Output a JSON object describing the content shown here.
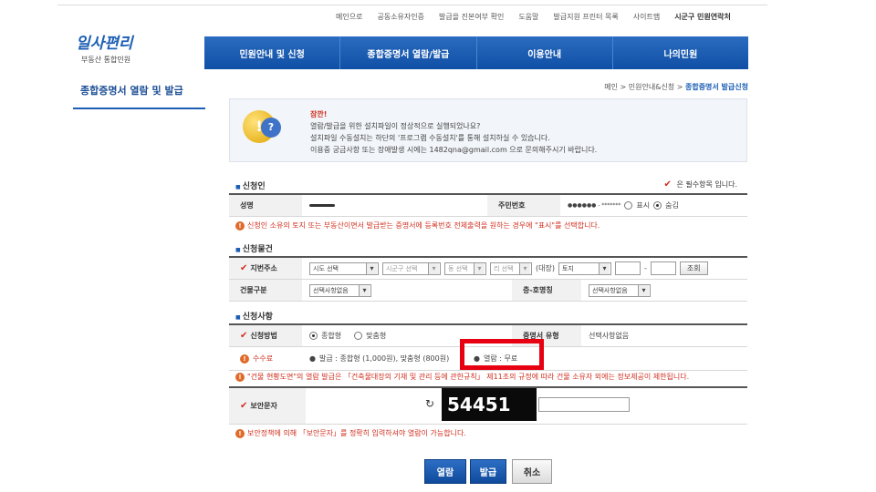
{
  "top_nav": [
    "메인으로",
    "공동소유자인증",
    "발급을 진본여부 확인",
    "도움말",
    "발급지원 프린터 목록",
    "사이트맵",
    "시군구 민원연락처"
  ],
  "logo": {
    "mark": "일사편리",
    "sub": "부동산 통합민원"
  },
  "main_nav": [
    "민원안내 및 신청",
    "종합증명서 열람/발급",
    "이용안내",
    "나의민원"
  ],
  "left_title": "종합증명서 열람 및 발급",
  "breadcrumb": {
    "home": "메인",
    "sep1": " > ",
    "mid": "민원안내&신청",
    "sep2": " > ",
    "current": "종합증명서 발급신청"
  },
  "notice": {
    "title": "잠깐!",
    "line1": "열람/발급을 위한 설치파일이 정상적으로 실행되었나요?",
    "line2": "설치파일 수동설치는 하단의 '프로그램 수동설치'를 통해 설치하실 수 있습니다.",
    "line3": "이용중 궁금사항 또는 장애발생 시에는 1482qna@gmail.com 으로 문의해주시기 바랍니다."
  },
  "required_note": "은 필수항목 입니다.",
  "applicant": {
    "heading": "신청인",
    "name_label": "성명",
    "rrn_label": "주민번호",
    "rrn_mask": "●●●●●● - *******",
    "show_label": "표시",
    "hide_label": "숨김",
    "warning": "신청인 소유의 토지 또는 부동산이면서 발급받는 증명서에 등록번호 전체출력을 원하는 경우에 \"표시\"를 선택합니다."
  },
  "property": {
    "heading": "신청물건",
    "address_label": "지번주소",
    "sido": "시도 선택",
    "sigungu": "시군구 선택",
    "dong": "동 선택",
    "ri": "리 선택",
    "daejang_label": "(대장)",
    "land_type": "토지",
    "dash": "-",
    "lookup_button": "조회",
    "building_label": "건물구분",
    "building_select": "선택사항없음",
    "floor_label": "층-호명칭",
    "floor_select": "선택사항없음"
  },
  "request": {
    "heading": "신청사항",
    "method_label": "신청방법",
    "method_general": "종합형",
    "method_custom": "맞춤형",
    "cert_type_label": "증명서 유형",
    "cert_type_value": "선택사항없음",
    "fee_label": "수수료",
    "fee_issue": "발급 : 종합형 (1,000원), 맞춤형 (800원)",
    "fee_view": "열람 : 무료",
    "warning": "\"건물 현황도면\"의 열람 발급은 「건축물대장의 기재 및 관리 등에 관한규칙」 제11조의 규정에 따라 건물 소유자 외에는 정보제공이 제한됩니다."
  },
  "security": {
    "label": "보안문자",
    "captcha": "54451",
    "warning": "보안정책에 의해 「보안문자」를 정확히 입력하셔야 열람이 가능합니다."
  },
  "buttons": {
    "view": "열람",
    "issue": "발급",
    "cancel": "취소"
  },
  "colors": {
    "brand_blue": "#1d5fb5",
    "highlight_red": "#e60012",
    "warning_red": "#d03020"
  }
}
